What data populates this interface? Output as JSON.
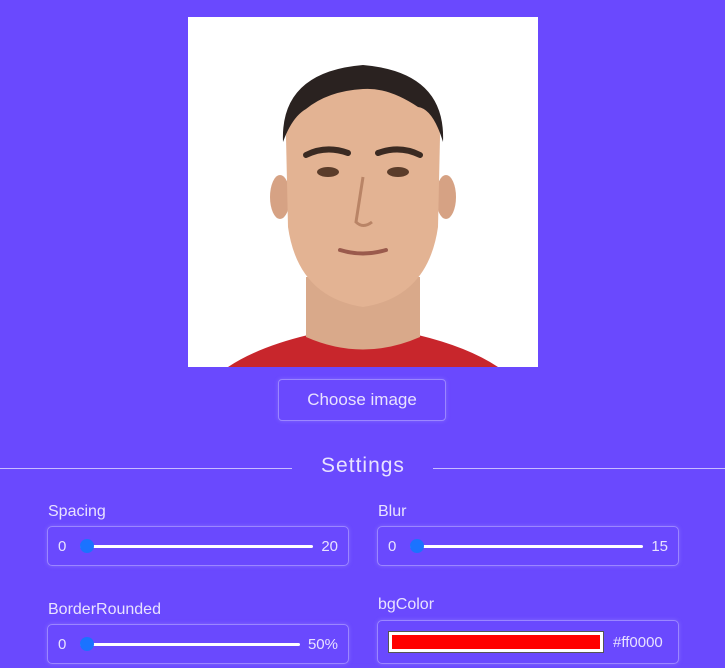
{
  "photo": {
    "alt": "portrait photo"
  },
  "choose_button": {
    "label": "Choose image"
  },
  "settings": {
    "title": "Settings"
  },
  "controls": {
    "spacing": {
      "label": "Spacing",
      "min": "0",
      "max": "20",
      "value": 0
    },
    "blur": {
      "label": "Blur",
      "min": "0",
      "max": "15",
      "value": 0
    },
    "border_rounded": {
      "label": "BorderRounded",
      "min": "0",
      "max": "50%",
      "value": 0
    },
    "bg_color": {
      "label": "bgColor",
      "value": "#ff0000",
      "swatch_color": "#ff0000"
    }
  },
  "colors": {
    "background": "#6a49fe",
    "slider_thumb": "#1a73ff",
    "border": "#9b86ff"
  }
}
